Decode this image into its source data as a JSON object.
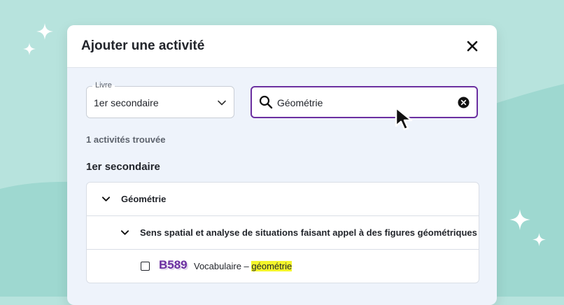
{
  "modal": {
    "title": "Ajouter une activité"
  },
  "filters": {
    "book_label": "Livre",
    "book_value": "1er secondaire",
    "search_value": "Géométrie"
  },
  "results": {
    "count_text": "1 activités trouvée",
    "section_title": "1er secondaire",
    "tree": {
      "level1_label": "Géométrie",
      "level2_label": "Sens spatial et analyse de situations faisant appel à des figures géométriques",
      "activity": {
        "code": "B589",
        "title_prefix": "Vocabulaire – ",
        "title_match": "géométrie",
        "checked": false
      }
    }
  },
  "colors": {
    "accent": "#6b2fa0",
    "highlight": "#f4f52b",
    "background_teal": "#b7e3dd"
  },
  "icons": [
    "close-icon",
    "chevron-down-icon",
    "search-icon",
    "clear-circle-icon",
    "sparkle-icon",
    "cursor-arrow-icon"
  ]
}
